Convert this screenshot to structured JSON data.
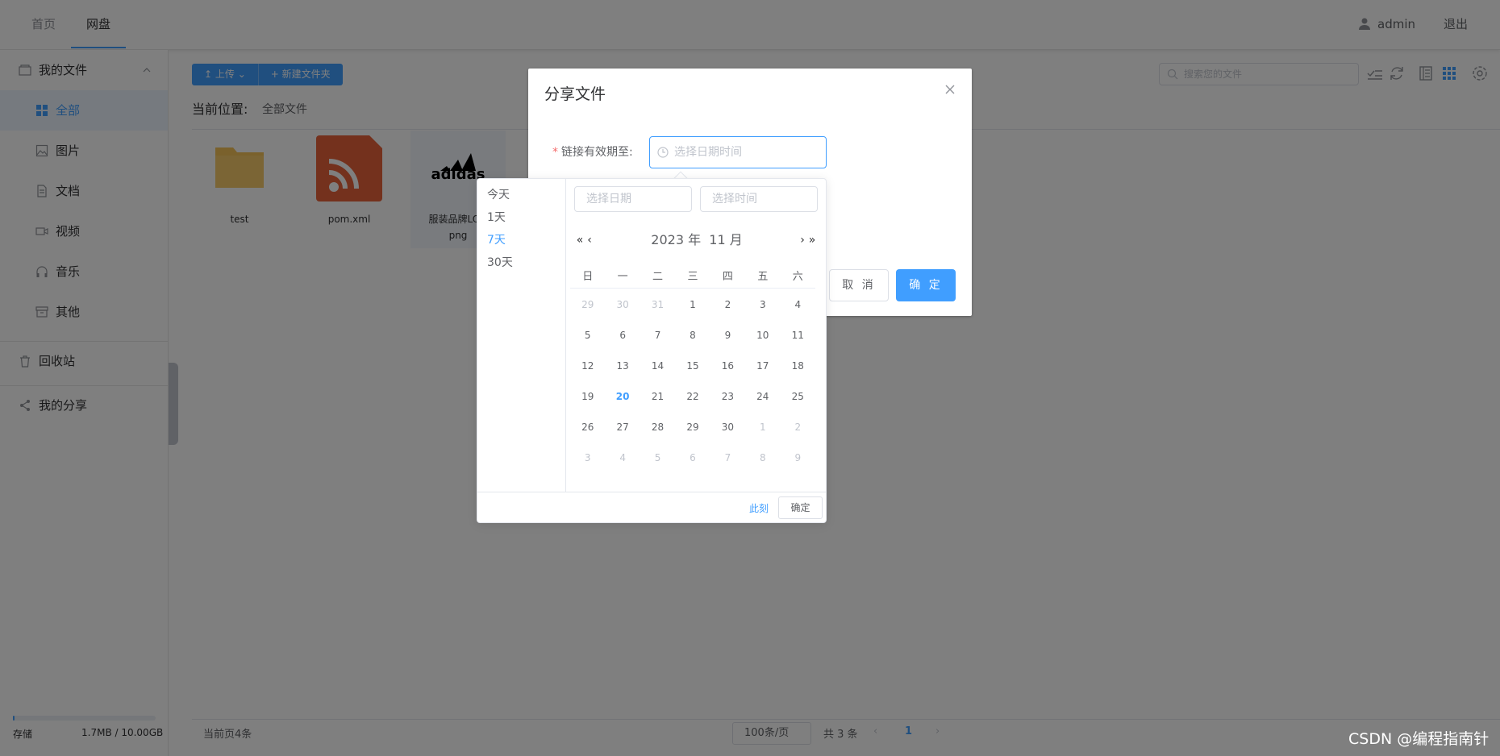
{
  "top_nav": {
    "tabs": [
      "首页",
      "网盘"
    ],
    "active_tab": "网盘",
    "username": "admin",
    "logout": "退出"
  },
  "sidebar": {
    "my_files": "我的文件",
    "categories": [
      "全部",
      "图片",
      "文档",
      "视频",
      "音乐",
      "其他"
    ],
    "active_category": "全部",
    "recycle": "回收站",
    "my_share": "我的分享",
    "storage_label": "存储",
    "storage_value": "1.7MB / 10.00GB"
  },
  "toolbar": {
    "upload": "上传",
    "new_folder": "新建文件夹",
    "search_placeholder": "搜索您的文件"
  },
  "breadcrumb": {
    "label": "当前位置:",
    "path": "全部文件"
  },
  "files": [
    {
      "name": "test",
      "type": "folder"
    },
    {
      "name": "pom.xml",
      "type": "xml"
    },
    {
      "name": "服装品牌LOGO.png",
      "name_line1": "服装品牌LOG",
      "name_line2": "png",
      "type": "image",
      "logo_text": "adidas"
    }
  ],
  "footer": {
    "page_count": "当前页4条",
    "page_size": "100条/页",
    "total": "共 3 条",
    "current_page": "1"
  },
  "dialog": {
    "title": "分享文件",
    "field_label": "链接有效期至:",
    "date_placeholder": "选择日期时间",
    "cancel": "取 消",
    "confirm": "确 定"
  },
  "date_picker": {
    "shortcuts": [
      "今天",
      "1天",
      "7天",
      "30天"
    ],
    "active_shortcut": "7天",
    "date_placeholder": "选择日期",
    "time_placeholder": "选择时间",
    "year_label": "2023 年",
    "month_label": "11 月",
    "weekdays": [
      "日",
      "一",
      "二",
      "三",
      "四",
      "五",
      "六"
    ],
    "weeks": [
      [
        "29",
        "30",
        "31",
        "1",
        "2",
        "3",
        "4"
      ],
      [
        "5",
        "6",
        "7",
        "8",
        "9",
        "10",
        "11"
      ],
      [
        "12",
        "13",
        "14",
        "15",
        "16",
        "17",
        "18"
      ],
      [
        "19",
        "20",
        "21",
        "22",
        "23",
        "24",
        "25"
      ],
      [
        "26",
        "27",
        "28",
        "29",
        "30",
        "1",
        "2"
      ],
      [
        "3",
        "4",
        "5",
        "6",
        "7",
        "8",
        "9"
      ]
    ],
    "today": "20",
    "now_label": "此刻",
    "ok_label": "确定"
  },
  "watermark": "CSDN @编程指南针",
  "colors": {
    "primary": "#409EFF",
    "required": "#F56C6C",
    "mask": "rgba(0,0,0,0.5)"
  }
}
